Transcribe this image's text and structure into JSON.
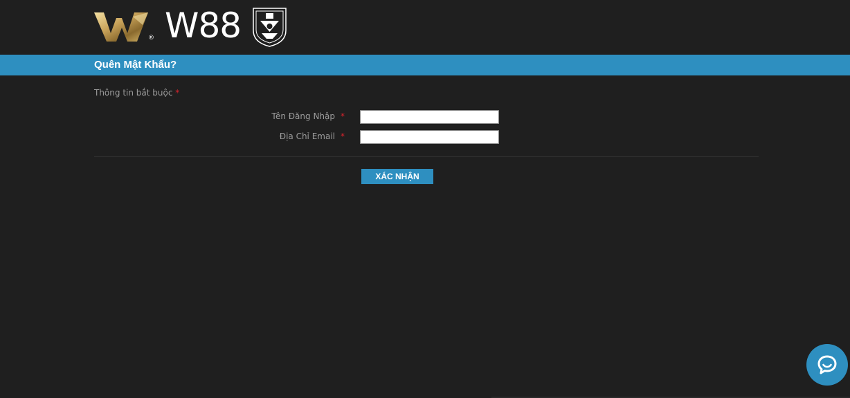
{
  "brand": {
    "name": "W88",
    "registered_mark": "®"
  },
  "page": {
    "title": "Quên Mật Khẩu?",
    "required_note": "Thông tin bắt buộc",
    "required_marker": "*"
  },
  "form": {
    "fields": [
      {
        "label": "Tên Đăng Nhập",
        "value": ""
      },
      {
        "label": "Địa Chỉ Email",
        "value": ""
      }
    ],
    "submit_label": "XÁC NHẬN"
  },
  "colors": {
    "background": "#1f1f1f",
    "accent": "#2e8fc0",
    "required": "#d9232d"
  },
  "icons": {
    "chat": "chat-bubble-icon"
  }
}
